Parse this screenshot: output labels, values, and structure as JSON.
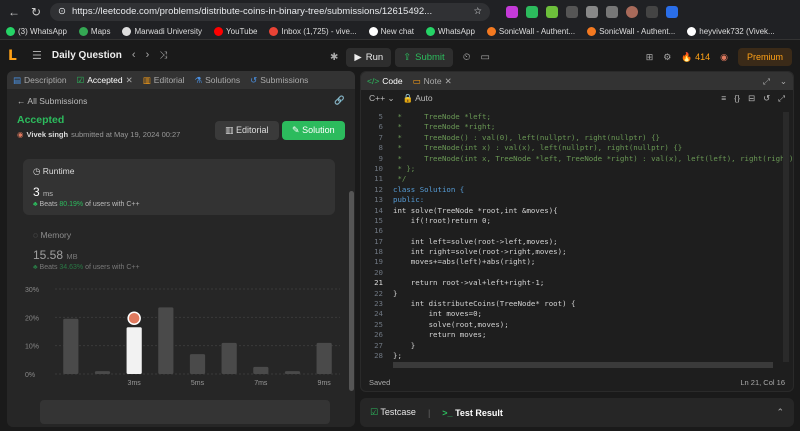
{
  "browser": {
    "url": "https://leetcode.com/problems/distribute-coins-in-binary-tree/submissions/12615492...",
    "bookmarks": [
      "(3) WhatsApp",
      "Maps",
      "Marwadi University",
      "YouTube",
      "Inbox (1,725) - vive...",
      "New chat",
      "WhatsApp",
      "SonicWall - Authent...",
      "SonicWall - Authent...",
      "heyvivek732 (Vivek..."
    ]
  },
  "header": {
    "title": "Daily Question",
    "run_label": "Run",
    "submit_label": "Submit",
    "streak": "414",
    "premium_label": "Premium"
  },
  "left": {
    "tabs": [
      "Description",
      "Accepted",
      "Editorial",
      "Solutions",
      "Submissions"
    ],
    "back_label": "All Submissions",
    "status": "Accepted",
    "user": "Vivek singh",
    "submitted_text": "submitted at May 19, 2024 00:27",
    "editorial_label": "Editorial",
    "solution_label": "Solution",
    "runtime": {
      "title": "Runtime",
      "value": "3",
      "unit": "ms",
      "beats_label": "Beats",
      "beats_pct": "80.19%",
      "beats_suffix": "of users with C++"
    },
    "memory": {
      "title": "Memory",
      "value": "15.58",
      "unit": "MB",
      "beats_label": "Beats",
      "beats_pct": "34.63%",
      "beats_suffix": "of users with C++"
    }
  },
  "chart_data": {
    "type": "bar",
    "categories": [
      "1ms",
      "2ms",
      "3ms",
      "4ms",
      "5ms",
      "6ms",
      "7ms",
      "8ms",
      "9ms"
    ],
    "tick_labels": [
      "3ms",
      "5ms",
      "7ms",
      "9ms"
    ],
    "values": [
      19.5,
      1,
      16.5,
      23.5,
      7,
      11,
      2.5,
      1,
      11
    ],
    "highlight_index": 2,
    "yticks": [
      "30%",
      "20%",
      "10%",
      "0%"
    ],
    "ylim": [
      0,
      30
    ]
  },
  "right": {
    "tabs": [
      "Code",
      "Note"
    ],
    "language": "C++",
    "mode": "Auto",
    "saved_label": "Saved",
    "cursor_label": "Ln 21, Col 16",
    "code_lines": [
      {
        "n": "5",
        "t": " *     TreeNode *left;",
        "c": "cm"
      },
      {
        "n": "6",
        "t": " *     TreeNode *right;",
        "c": "cm"
      },
      {
        "n": "7",
        "t": " *     TreeNode() : val(0), left(nullptr), right(nullptr) {}",
        "c": "cm"
      },
      {
        "n": "8",
        "t": " *     TreeNode(int x) : val(x), left(nullptr), right(nullptr) {}",
        "c": "cm"
      },
      {
        "n": "9",
        "t": " *     TreeNode(int x, TreeNode *left, TreeNode *right) : val(x), left(left), right(right) {}",
        "c": "cm"
      },
      {
        "n": "10",
        "t": " * };",
        "c": "cm"
      },
      {
        "n": "11",
        "t": " */",
        "c": "cm"
      },
      {
        "n": "12",
        "t": "class Solution {",
        "c": "kw"
      },
      {
        "n": "13",
        "t": "public:",
        "c": "kw"
      },
      {
        "n": "14",
        "t": "int solve(TreeNode *root,int &moves){",
        "c": "tx"
      },
      {
        "n": "15",
        "t": "    if(!root)return 0;",
        "c": "tx"
      },
      {
        "n": "16",
        "t": "",
        "c": "tx"
      },
      {
        "n": "17",
        "t": "    int left=solve(root->left,moves);",
        "c": "tx"
      },
      {
        "n": "18",
        "t": "    int right=solve(root->right,moves);",
        "c": "tx"
      },
      {
        "n": "19",
        "t": "    moves+=abs(left)+abs(right);",
        "c": "tx"
      },
      {
        "n": "20",
        "t": "",
        "c": "tx"
      },
      {
        "n": "21",
        "t": "    return root->val+left+right-1;",
        "c": "tx"
      },
      {
        "n": "22",
        "t": "}",
        "c": "tx"
      },
      {
        "n": "23",
        "t": "    int distributeCoins(TreeNode* root) {",
        "c": "tx"
      },
      {
        "n": "24",
        "t": "        int moves=0;",
        "c": "tx"
      },
      {
        "n": "25",
        "t": "        solve(root,moves);",
        "c": "tx"
      },
      {
        "n": "26",
        "t": "        return moves;",
        "c": "tx"
      },
      {
        "n": "27",
        "t": "    }",
        "c": "tx"
      },
      {
        "n": "28",
        "t": "};",
        "c": "tx"
      }
    ]
  },
  "bottom": {
    "testcase_label": "Testcase",
    "result_label": "Test Result"
  }
}
